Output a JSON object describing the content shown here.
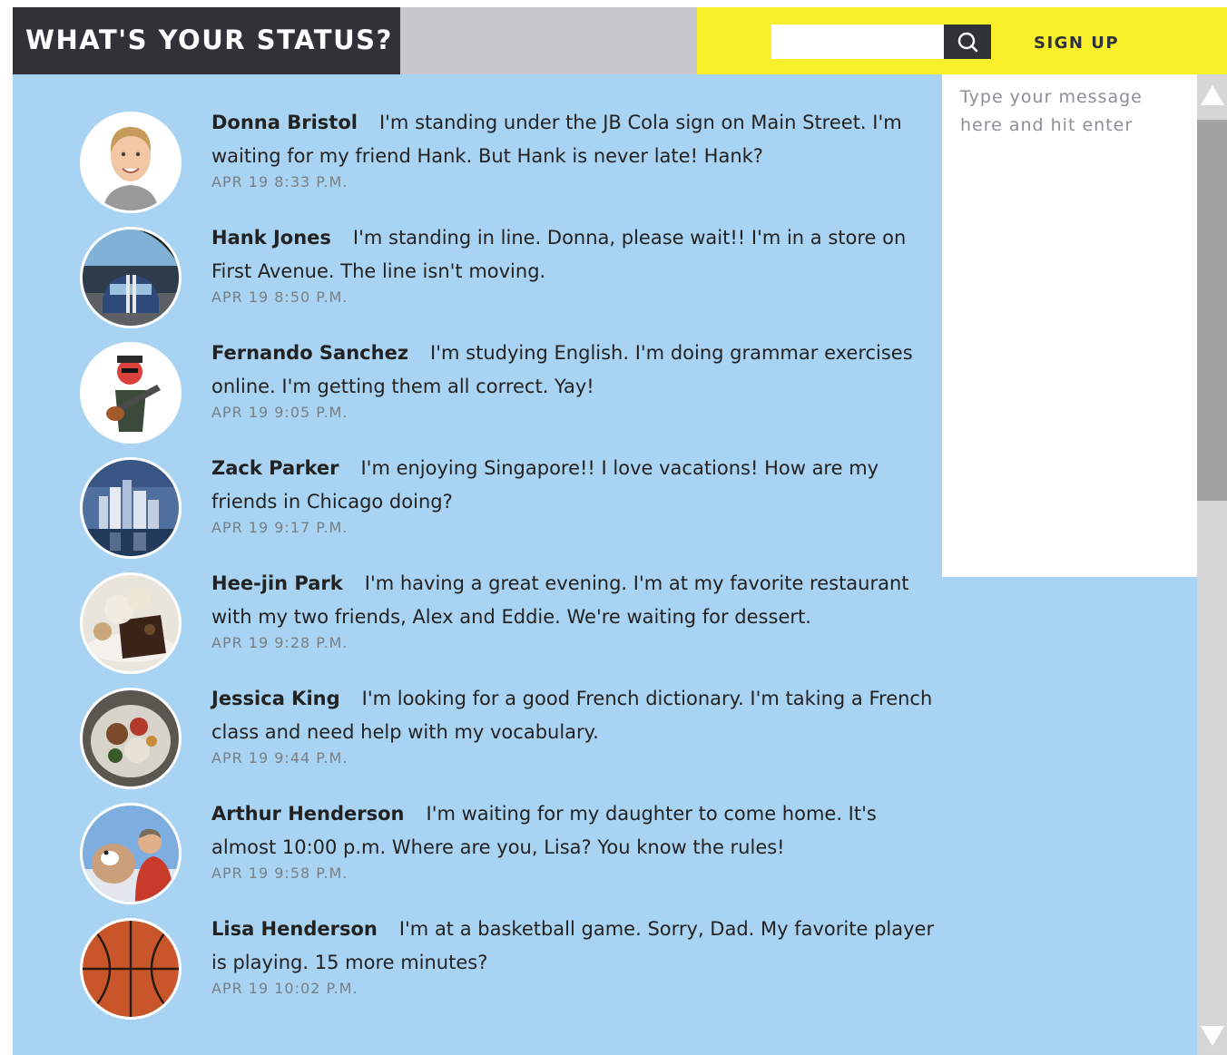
{
  "header": {
    "title": "WHAT'S YOUR STATUS?",
    "search_placeholder": "",
    "search_icon": "search-icon",
    "signup_label": "SIGN UP"
  },
  "composer": {
    "placeholder": "Type your message here and hit enter"
  },
  "posts": [
    {
      "name": "Donna Bristol",
      "text": "I'm standing under the JB Cola sign on Main Street. I'm waiting for my friend Hank. But Hank is never late! Hank?",
      "time": "APR 19 8:33 P.M."
    },
    {
      "name": "Hank Jones",
      "text": "I'm standing in line. Donna, please wait!! I'm in a store on First Avenue. The line isn't moving.",
      "time": "APR 19 8:50 P.M."
    },
    {
      "name": "Fernando Sanchez",
      "text": "I'm studying English. I'm doing grammar exercises online. I'm getting them all correct. Yay!",
      "time": "APR 19 9:05 P.M."
    },
    {
      "name": "Zack Parker",
      "text": "I'm enjoying Singapore!! I love vacations! How are my friends in Chicago doing?",
      "time": "APR 19 9:17 P.M."
    },
    {
      "name": "Hee-jin Park",
      "text": "I'm having a great evening. I'm at my favorite restaurant with my two friends, Alex and Eddie. We're waiting for dessert.",
      "time": "APR 19 9:28 P.M."
    },
    {
      "name": "Jessica King",
      "text": "I'm looking for a good French dictionary. I'm taking a French class and need help with my vocabulary.",
      "time": "APR 19 9:44 P.M."
    },
    {
      "name": "Arthur Henderson",
      "text": "I'm waiting for my daughter to come home. It's almost 10:00 p.m. Where are you, Lisa? You know the rules!",
      "time": "APR 19 9:58 P.M."
    },
    {
      "name": "Lisa Henderson",
      "text": "I'm at a basketball game. Sorry, Dad. My favorite player is playing. 15 more minutes?",
      "time": "APR 19 10:02 P.M."
    }
  ],
  "colors": {
    "background": "#a9d3f2",
    "header_dark": "#2f3338",
    "header_yellow": "#f9ef2a",
    "header_gray": "#c5c8cc"
  }
}
